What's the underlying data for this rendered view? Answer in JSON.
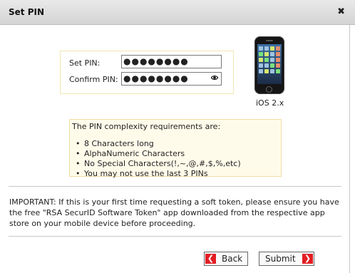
{
  "dialog": {
    "title": "Set PIN",
    "close_symbol": "✖"
  },
  "pin_form": {
    "set_pin_label": "Set PIN:",
    "set_pin_value": "●●●●●●●●",
    "confirm_pin_label": "Confirm PIN:",
    "confirm_pin_value": "●●●●●●●●"
  },
  "device": {
    "label": "iOS 2.x",
    "icon": "iphone-icon"
  },
  "requirements": {
    "heading": "The PIN complexity requirements are:",
    "items": [
      "8 Characters long",
      "AlphaNumeric Characters",
      "No Special Characters(!,~,@,#,$,%,etc)",
      "You may not use the last 3 PINs"
    ]
  },
  "notice": "IMPORTANT: If this is your first time requesting a soft token, please ensure you have the free \"RSA SecurID Software Token\" app downloaded from the respective app store on your mobile device before proceeding.",
  "buttons": {
    "back_label": "Back",
    "submit_label": "Submit",
    "back_arrow": "❮",
    "submit_arrow": "❯"
  },
  "colors": {
    "accent_red": "#e31e24",
    "requirements_bg": "#fffbea"
  }
}
